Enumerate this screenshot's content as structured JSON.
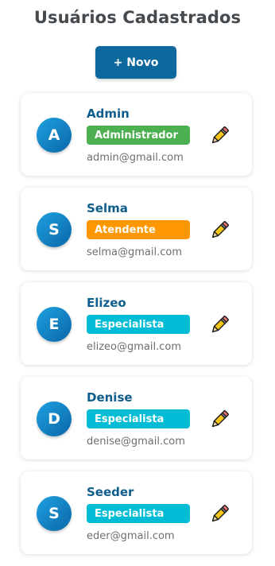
{
  "header": {
    "title": "Usuários Cadastrados",
    "new_button_label": "+ Novo"
  },
  "users": [
    {
      "initial": "A",
      "name": "Admin",
      "role": "Administrador",
      "role_color": "#4caf50",
      "email": "admin@gmail.com"
    },
    {
      "initial": "S",
      "name": "Selma",
      "role": "Atendente",
      "role_color": "#ff9800",
      "email": "selma@gmail.com"
    },
    {
      "initial": "E",
      "name": "Elizeo",
      "role": "Especialista",
      "role_color": "#00bcd4",
      "email": "elizeo@gmail.com"
    },
    {
      "initial": "D",
      "name": "Denise",
      "role": "Especialista",
      "role_color": "#00bcd4",
      "email": "denise@gmail.com"
    },
    {
      "initial": "S",
      "name": "Seeder",
      "role": "Especialista",
      "role_color": "#00bcd4",
      "email": "eder@gmail.com"
    }
  ],
  "icons": {
    "edit": "pencil-icon"
  },
  "colors": {
    "primary": "#0d689e",
    "name_text": "#0e5d8c",
    "title_text": "#454a4f"
  }
}
